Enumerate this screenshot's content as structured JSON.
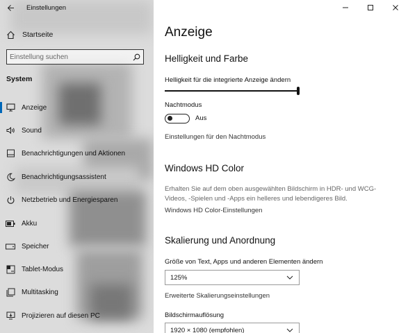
{
  "window": {
    "title": "Einstellungen"
  },
  "sidebar": {
    "home_label": "Startseite",
    "search_placeholder": "Einstellung suchen",
    "section": "System",
    "items": [
      {
        "label": "Anzeige",
        "icon": "monitor-icon"
      },
      {
        "label": "Sound",
        "icon": "speaker-icon"
      },
      {
        "label": "Benachrichtigungen und Aktionen",
        "icon": "notification-icon"
      },
      {
        "label": "Benachrichtigungsassistent",
        "icon": "moon-icon"
      },
      {
        "label": "Netzbetrieb und Energiesparen",
        "icon": "power-icon"
      },
      {
        "label": "Akku",
        "icon": "battery-icon"
      },
      {
        "label": "Speicher",
        "icon": "storage-icon"
      },
      {
        "label": "Tablet-Modus",
        "icon": "tablet-mode-icon"
      },
      {
        "label": "Multitasking",
        "icon": "multitasking-icon"
      },
      {
        "label": "Projizieren auf diesen PC",
        "icon": "project-icon"
      }
    ],
    "active_index": 0
  },
  "main": {
    "title": "Anzeige",
    "brightness": {
      "heading": "Helligkeit und Farbe",
      "slider_label": "Helligkeit für die integrierte Anzeige ändern",
      "level_fraction": 1.0
    },
    "night_mode": {
      "label": "Nachtmodus",
      "state": "Aus",
      "settings_link": "Einstellungen für den Nachtmodus"
    },
    "hd_color": {
      "heading": "Windows HD Color",
      "desc_line1": "Erhalten Sie auf dem oben ausgewählten Bildschirm in HDR- und WCG-",
      "desc_line2": "Videos, -Spielen und -Apps ein helleres und lebendigeres Bild.",
      "link": "Windows HD Color-Einstellungen"
    },
    "scaling": {
      "heading": "Skalierung und Anordnung",
      "size_label": "Größe von Text, Apps und anderen Elementen ändern",
      "size_value": "125%",
      "advanced_link": "Erweiterte Skalierungseinstellungen",
      "resolution_label": "Bildschirmauflösung",
      "resolution_value": "1920 × 1080 (empfohlen)"
    }
  },
  "colors": {
    "accent": "#0067b8",
    "text": "#111111",
    "muted": "#666666"
  }
}
